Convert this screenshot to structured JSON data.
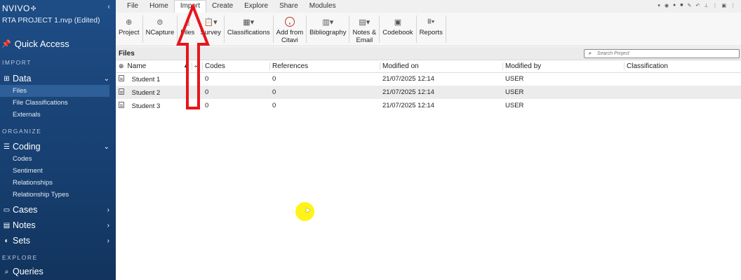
{
  "app": {
    "logo": "NVIVO",
    "logo_mark": "✣",
    "project_title": "RTA PROJECT 1.nvp (Edited)"
  },
  "sidebar": {
    "quick_access": "Quick Access",
    "sections": {
      "import": "IMPORT",
      "organize": "ORGANIZE",
      "explore": "EXPLORE"
    },
    "data": {
      "label": "Data",
      "items": [
        "Files",
        "File Classifications",
        "Externals"
      ]
    },
    "coding": {
      "label": "Coding",
      "items": [
        "Codes",
        "Sentiment",
        "Relationships",
        "Relationship Types"
      ]
    },
    "cases": "Cases",
    "notes": "Notes",
    "sets": "Sets",
    "queries": "Queries"
  },
  "tabs": [
    "File",
    "Home",
    "Import",
    "Create",
    "Explore",
    "Share",
    "Modules"
  ],
  "active_tab": "Import",
  "ribbon": {
    "project": "Project",
    "ncapture": "NCapture",
    "files": "Files",
    "survey": "Survey",
    "classifications": "Classifications",
    "citavi_line1": "Add from",
    "citavi_line2": "Citavi",
    "bibliography": "Bibliography",
    "notes_line1": "Notes &",
    "notes_line2": "Email",
    "codebook": "Codebook",
    "reports": "Reports"
  },
  "pane": {
    "title": "Files",
    "search_placeholder": "Search Project"
  },
  "table": {
    "columns": [
      "Name",
      "Codes",
      "References",
      "Modified on",
      "Modified by",
      "Classification"
    ],
    "rows": [
      {
        "name": "Student 1",
        "codes": "0",
        "references": "0",
        "modified_on": "21/07/2025 12:14",
        "modified_by": "USER",
        "classification": ""
      },
      {
        "name": "Student 2",
        "codes": "0",
        "references": "0",
        "modified_on": "21/07/2025 12:14",
        "modified_by": "USER",
        "classification": ""
      },
      {
        "name": "Student 3",
        "codes": "0",
        "references": "0",
        "modified_on": "21/07/2025 12:14",
        "modified_by": "USER",
        "classification": ""
      }
    ]
  },
  "colors": {
    "sidebar": "#1e4d86",
    "annotation_arrow": "#e8141c",
    "cursor_highlight": "#fff200"
  }
}
